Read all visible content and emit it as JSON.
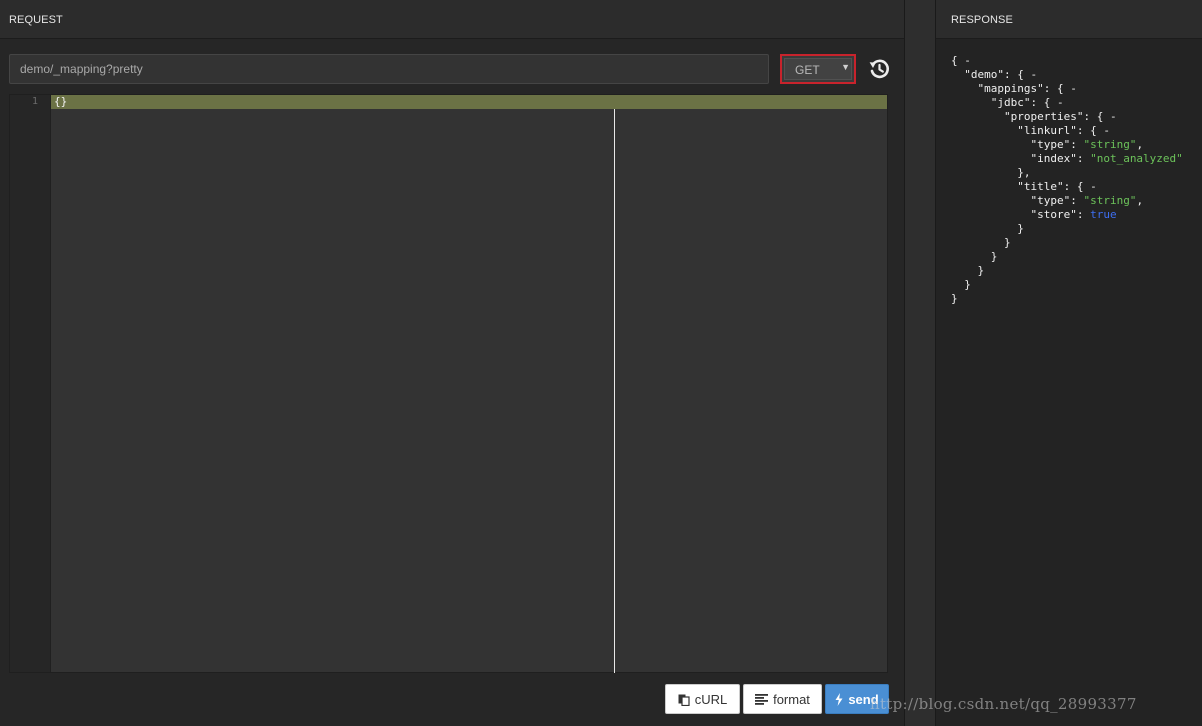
{
  "request": {
    "header": "REQUEST",
    "url": "demo/_mapping?pretty",
    "method": "GET",
    "editor": {
      "line_number": "1",
      "content": "{}"
    },
    "buttons": {
      "curl": "cURL",
      "format": "format",
      "send": "send"
    }
  },
  "response": {
    "header": "RESPONSE",
    "lines": [
      [
        {
          "t": "{ -"
        }
      ],
      [
        {
          "t": "  \"demo\": { -"
        }
      ],
      [
        {
          "t": "    \"mappings\": { -"
        }
      ],
      [
        {
          "t": "      \"jdbc\": { -"
        }
      ],
      [
        {
          "t": "        \"properties\": { -"
        }
      ],
      [
        {
          "t": "          \"linkurl\": { -"
        }
      ],
      [
        {
          "t": "            \"type\": "
        },
        {
          "t": "\"string\"",
          "c": "str"
        },
        {
          "t": ","
        }
      ],
      [
        {
          "t": "            \"index\": "
        },
        {
          "t": "\"not_analyzed\"",
          "c": "str"
        }
      ],
      [
        {
          "t": "          },"
        }
      ],
      [
        {
          "t": "          \"title\": { -"
        }
      ],
      [
        {
          "t": "            \"type\": "
        },
        {
          "t": "\"string\"",
          "c": "str"
        },
        {
          "t": ","
        }
      ],
      [
        {
          "t": "            \"store\": "
        },
        {
          "t": "true",
          "c": "bool"
        }
      ],
      [
        {
          "t": "          }"
        }
      ],
      [
        {
          "t": "        }"
        }
      ],
      [
        {
          "t": "      }"
        }
      ],
      [
        {
          "t": "    }"
        }
      ],
      [
        {
          "t": "  }"
        }
      ],
      [
        {
          "t": "}"
        }
      ]
    ]
  },
  "watermark": "http://blog.csdn.net/qq_28993377",
  "colors": {
    "accent_border": "#c8232c",
    "send_button": "#4a8fd4",
    "json_string": "#6cc25a",
    "json_boolean": "#3d6ef0"
  }
}
